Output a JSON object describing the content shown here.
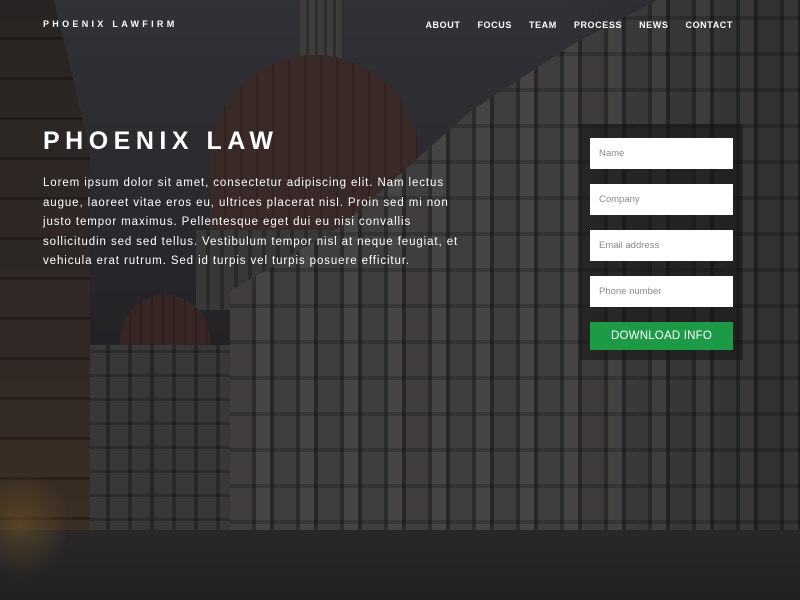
{
  "brand": "PHOENIX LAWFIRM",
  "nav": {
    "items": [
      "ABOUT",
      "FOCUS",
      "TEAM",
      "PROCESS",
      "NEWS",
      "CONTACT"
    ]
  },
  "hero": {
    "title": "PHOENIX LAW",
    "text": "Lorem ipsum dolor sit amet, consectetur adipiscing elit. Nam lectus augue, laoreet vitae eros eu, ultrices placerat nisl. Proin sed mi non justo tempor maximus. Pellentesque eget dui eu nisi convallis sollicitudin sed sed tellus. Vestibulum tempor nisl at neque feugiat, et vehicula erat rutrum. Sed id turpis vel turpis posuere efficitur."
  },
  "form": {
    "fields": [
      {
        "placeholder": "Name",
        "value": ""
      },
      {
        "placeholder": "Company",
        "value": ""
      },
      {
        "placeholder": "Email address",
        "value": ""
      },
      {
        "placeholder": "Phone number",
        "value": ""
      }
    ],
    "submit_label": "DOWNLOAD INFO",
    "submit_color": "#1c9a45"
  },
  "background": {
    "description_icon": "cathedral-photo",
    "overlay_color": "#0f0f12"
  }
}
